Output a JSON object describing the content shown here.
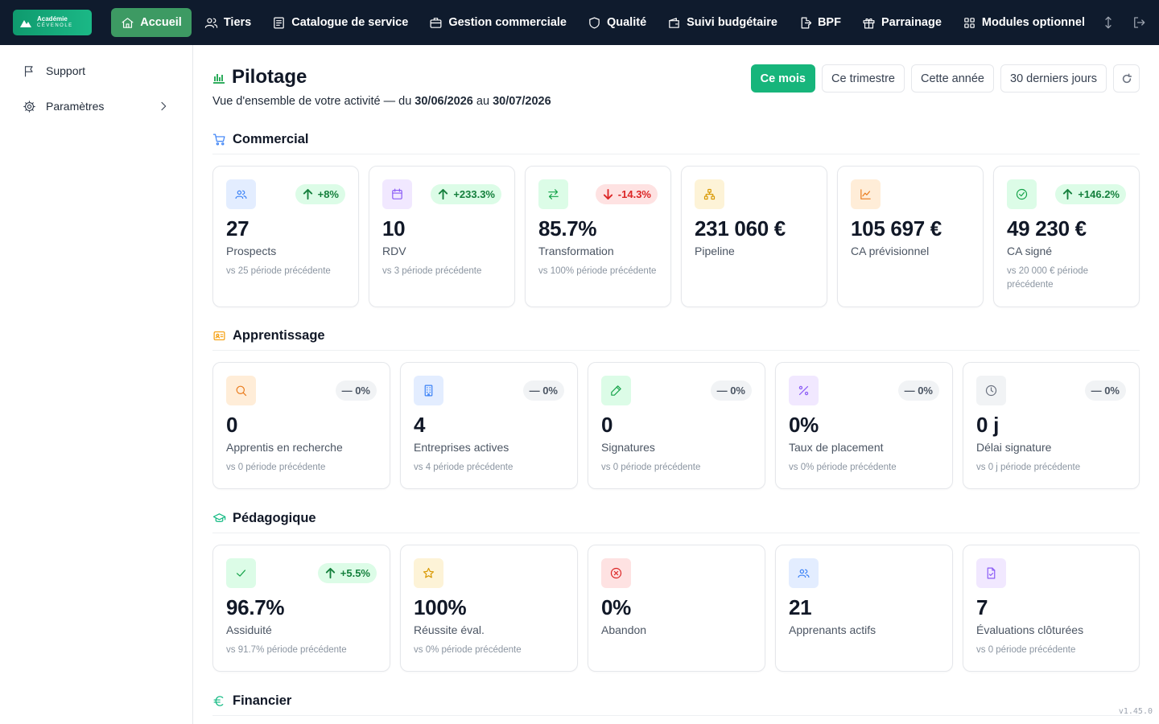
{
  "brand": {
    "line1": "Académie",
    "line2": "CÉVENOLE"
  },
  "nav": [
    {
      "label": "Accueil",
      "icon": "home-icon",
      "active": true
    },
    {
      "label": "Tiers",
      "icon": "users-icon"
    },
    {
      "label": "Catalogue de service",
      "icon": "book-icon"
    },
    {
      "label": "Gestion commerciale",
      "icon": "briefcase-icon"
    },
    {
      "label": "Qualité",
      "icon": "shield-icon"
    },
    {
      "label": "Suivi budgétaire",
      "icon": "wallet-icon"
    },
    {
      "label": "BPF",
      "icon": "file-export-icon"
    },
    {
      "label": "Parrainage",
      "icon": "gift-icon"
    },
    {
      "label": "Modules optionnel",
      "icon": "grid-icon"
    }
  ],
  "sidebar": {
    "support": "Support",
    "settings": "Paramètres"
  },
  "header": {
    "title": "Pilotage",
    "subtitle_prefix": "Vue d'ensemble de votre activité — du ",
    "date_from": "30/06/2026",
    "subtitle_mid": " au ",
    "date_to": "30/07/2026"
  },
  "periods": {
    "month": "Ce mois",
    "quarter": "Ce trimestre",
    "year": "Cette année",
    "last30": "30 derniers jours"
  },
  "sections": {
    "commercial": {
      "title": "Commercial",
      "cards": [
        {
          "value": "27",
          "label": "Prospects",
          "vs": "vs 25 période précédente",
          "trend": "+8%"
        },
        {
          "value": "10",
          "label": "RDV",
          "vs": "vs 3 période précédente",
          "trend": "+233.3%"
        },
        {
          "value": "85.7%",
          "label": "Transformation",
          "vs": "vs 100% période précédente",
          "trend": "-14.3%"
        },
        {
          "value": "231 060 €",
          "label": "Pipeline"
        },
        {
          "value": "105 697 €",
          "label": "CA prévisionnel"
        },
        {
          "value": "49 230 €",
          "label": "CA signé",
          "vs": "vs 20 000 € période précédente",
          "trend": "+146.2%"
        }
      ]
    },
    "apprentissage": {
      "title": "Apprentissage",
      "cards": [
        {
          "value": "0",
          "label": "Apprentis en recherche",
          "vs": "vs 0 période précédente",
          "trend": "— 0%"
        },
        {
          "value": "4",
          "label": "Entreprises actives",
          "vs": "vs 4 période précédente",
          "trend": "— 0%"
        },
        {
          "value": "0",
          "label": "Signatures",
          "vs": "vs 0 période précédente",
          "trend": "— 0%"
        },
        {
          "value": "0%",
          "label": "Taux de placement",
          "vs": "vs 0% période précédente",
          "trend": "— 0%"
        },
        {
          "value": "0 j",
          "label": "Délai signature",
          "vs": "vs 0 j période précédente",
          "trend": "— 0%"
        }
      ]
    },
    "pedagogique": {
      "title": "Pédagogique",
      "cards": [
        {
          "value": "96.7%",
          "label": "Assiduité",
          "vs": "vs 91.7% période précédente",
          "trend": "+5.5%"
        },
        {
          "value": "100%",
          "label": "Réussite éval.",
          "vs": "vs 0% période précédente"
        },
        {
          "value": "0%",
          "label": "Abandon"
        },
        {
          "value": "21",
          "label": "Apprenants actifs"
        },
        {
          "value": "7",
          "label": "Évaluations clôturées",
          "vs": "vs 0 période précédente"
        }
      ]
    },
    "financier": {
      "title": "Financier"
    }
  },
  "version": "v1.45.0"
}
